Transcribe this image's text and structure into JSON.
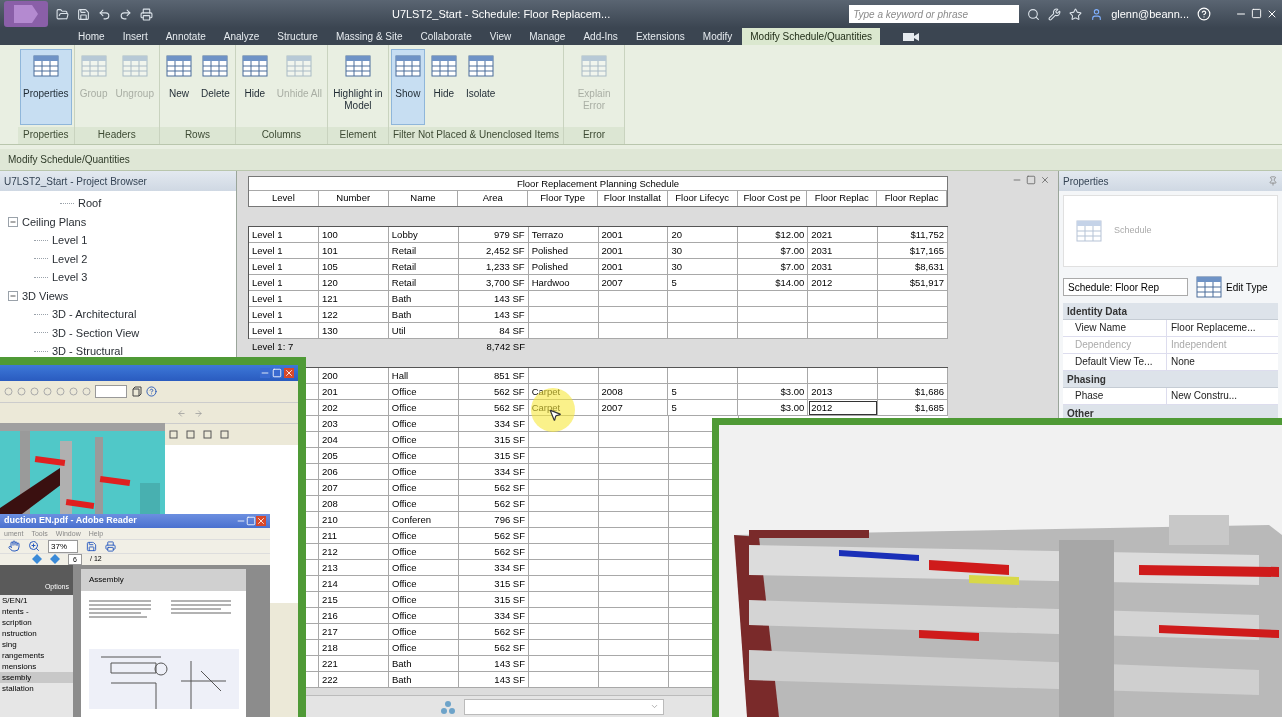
{
  "window": {
    "title": "U7LST2_Start - Schedule: Floor Replacem...",
    "search_placeholder": "Type a keyword or phrase",
    "user": "glenn@beann..."
  },
  "tabs": [
    {
      "label": "Home",
      "selected": false
    },
    {
      "label": "Insert",
      "selected": false
    },
    {
      "label": "Annotate",
      "selected": false
    },
    {
      "label": "Analyze",
      "selected": false
    },
    {
      "label": "Structure",
      "selected": false
    },
    {
      "label": "Massing & Site",
      "selected": false
    },
    {
      "label": "Collaborate",
      "selected": false
    },
    {
      "label": "View",
      "selected": false
    },
    {
      "label": "Manage",
      "selected": false
    },
    {
      "label": "Add-Ins",
      "selected": false
    },
    {
      "label": "Extensions",
      "selected": false
    },
    {
      "label": "Modify",
      "selected": false
    },
    {
      "label": "Modify Schedule/Quantities",
      "selected": true
    }
  ],
  "ribbon": {
    "panels": [
      {
        "label": "Properties",
        "buttons": [
          {
            "label": "Properties",
            "disabled": false,
            "active": true
          }
        ]
      },
      {
        "label": "Headers",
        "buttons": [
          {
            "label": "Group",
            "disabled": true,
            "active": false
          },
          {
            "label": "Ungroup",
            "disabled": true,
            "active": false
          }
        ]
      },
      {
        "label": "Rows",
        "buttons": [
          {
            "label": "New",
            "disabled": false,
            "active": false
          },
          {
            "label": "Delete",
            "disabled": false,
            "active": false
          }
        ]
      },
      {
        "label": "Columns",
        "buttons": [
          {
            "label": "Hide",
            "disabled": false,
            "active": false
          },
          {
            "label": "Unhide All",
            "disabled": true,
            "active": false
          }
        ]
      },
      {
        "label": "Element",
        "buttons": [
          {
            "label": "Highlight in Model",
            "disabled": false,
            "active": false
          }
        ]
      },
      {
        "label": "Filter Not Placed & Unenclosed Items",
        "buttons": [
          {
            "label": "Show",
            "disabled": false,
            "active": true
          },
          {
            "label": "Hide",
            "disabled": false,
            "active": false
          },
          {
            "label": "Isolate",
            "disabled": false,
            "active": false
          }
        ]
      },
      {
        "label": "Error",
        "buttons": [
          {
            "label": "Explain Error",
            "disabled": true,
            "active": false
          }
        ]
      }
    ]
  },
  "context_bar": "Modify Schedule/Quantities",
  "browser": {
    "title": "U7LST2_Start - Project Browser",
    "tree": [
      {
        "children": [
          {
            "label": "Roof"
          }
        ]
      },
      {
        "label": "Ceiling Plans",
        "expanded": true,
        "children": [
          {
            "label": "Level 1"
          },
          {
            "label": "Level 2"
          },
          {
            "label": "Level 3"
          }
        ]
      },
      {
        "label": "3D Views",
        "expanded": true,
        "children": [
          {
            "label": "3D - Architectural"
          },
          {
            "label": "3D - Section View"
          },
          {
            "label": "3D - Structural"
          }
        ]
      }
    ]
  },
  "schedule": {
    "title": "Floor Replacement Planning Schedule",
    "columns": [
      "Level",
      "Number",
      "Name",
      "Area",
      "Floor Type",
      "Floor Installat",
      "Floor Lifecyc",
      "Floor Cost pe",
      "Floor Replac",
      "Floor Replac"
    ],
    "groups": [
      {
        "rows": [
          {
            "level": "Level 1",
            "number": "100",
            "name": "Lobby",
            "area": "979 SF",
            "floor_type": "Terrazo",
            "installed": "2001",
            "lifecycle": "20",
            "cost": "$12.00",
            "replace_year": "2021",
            "replace_cost": "$11,752",
            "active": false
          },
          {
            "level": "Level 1",
            "number": "101",
            "name": "Retail",
            "area": "2,452 SF",
            "floor_type": "Polished",
            "installed": "2001",
            "lifecycle": "30",
            "cost": "$7.00",
            "replace_year": "2031",
            "replace_cost": "$17,165",
            "active": false
          },
          {
            "level": "Level 1",
            "number": "105",
            "name": "Retail",
            "area": "1,233 SF",
            "floor_type": "Polished",
            "installed": "2001",
            "lifecycle": "30",
            "cost": "$7.00",
            "replace_year": "2031",
            "replace_cost": "$8,631",
            "active": false
          },
          {
            "level": "Level 1",
            "number": "120",
            "name": "Retail",
            "area": "3,700 SF",
            "floor_type": "Hardwoo",
            "installed": "2007",
            "lifecycle": "5",
            "cost": "$14.00",
            "replace_year": "2012",
            "replace_cost": "$51,917",
            "active": false
          },
          {
            "level": "Level 1",
            "number": "121",
            "name": "Bath",
            "area": "143 SF",
            "active": false
          },
          {
            "level": "Level 1",
            "number": "122",
            "name": "Bath",
            "area": "143 SF",
            "active": false
          },
          {
            "level": "Level 1",
            "number": "130",
            "name": "Util",
            "area": "84 SF",
            "active": false
          }
        ],
        "footer": {
          "label": "Level 1: 7",
          "area": "8,742 SF"
        }
      },
      {
        "rows": [
          {
            "number": "200",
            "name": "Hall",
            "area": "851 SF",
            "active": false
          },
          {
            "number": "201",
            "name": "Office",
            "area": "562 SF",
            "floor_type": "Carpet",
            "installed": "2008",
            "lifecycle": "5",
            "cost": "$3.00",
            "replace_year": "2013",
            "replace_cost": "$1,686",
            "active": false
          },
          {
            "number": "202",
            "name": "Office",
            "area": "562 SF",
            "floor_type": "Carpet",
            "installed": "2007",
            "lifecycle": "5",
            "cost": "$3.00",
            "replace_year": "2012",
            "replace_cost": "$1,685",
            "active": true
          },
          {
            "number": "203",
            "name": "Office",
            "area": "334 SF"
          },
          {
            "number": "204",
            "name": "Office",
            "area": "315 SF"
          },
          {
            "number": "205",
            "name": "Office",
            "area": "315 SF"
          },
          {
            "number": "206",
            "name": "Office",
            "area": "334 SF"
          },
          {
            "number": "207",
            "name": "Office",
            "area": "562 SF"
          },
          {
            "number": "208",
            "name": "Office",
            "area": "562 SF"
          },
          {
            "number": "210",
            "name": "Conferen",
            "area": "796 SF"
          },
          {
            "number": "211",
            "name": "Office",
            "area": "562 SF"
          },
          {
            "number": "212",
            "name": "Office",
            "area": "562 SF"
          },
          {
            "number": "213",
            "name": "Office",
            "area": "334 SF"
          },
          {
            "number": "214",
            "name": "Office",
            "area": "315 SF"
          },
          {
            "number": "215",
            "name": "Office",
            "area": "315 SF"
          },
          {
            "number": "216",
            "name": "Office",
            "area": "334 SF"
          },
          {
            "number": "217",
            "name": "Office",
            "area": "562 SF"
          },
          {
            "number": "218",
            "name": "Office",
            "area": "562 SF"
          },
          {
            "number": "221",
            "name": "Bath",
            "area": "143 SF"
          },
          {
            "number": "222",
            "name": "Bath",
            "area": "143 SF"
          }
        ]
      }
    ]
  },
  "properties": {
    "title": "Properties",
    "type_label": "Schedule",
    "type_selector": "Schedule: Floor Rep",
    "edit_type": "Edit Type",
    "groups": [
      {
        "label": "Identity Data",
        "rows": [
          {
            "name": "View Name",
            "value": "Floor Replaceme...",
            "disabled": false
          },
          {
            "name": "Dependency",
            "value": "Independent",
            "disabled": true
          },
          {
            "name": "Default View Te...",
            "value": "None",
            "disabled": false
          }
        ]
      },
      {
        "label": "Phasing",
        "rows": [
          {
            "name": "Phase",
            "value": "New Constru...",
            "disabled": false
          }
        ]
      },
      {
        "label": "Other"
      }
    ]
  },
  "reader": {
    "title": "duction EN.pdf - Adobe Reader",
    "menu": [
      "ument",
      "Tools",
      "Window",
      "Help"
    ],
    "zoom": "37%",
    "page": "6",
    "page_count": "/ 12",
    "options": "Options",
    "bookmarks": [
      {
        "label": "S/EN/1",
        "selected": false
      },
      {
        "label": "ntents -",
        "selected": false
      },
      {
        "label": "scription",
        "selected": false
      },
      {
        "label": "nstruction",
        "selected": false
      },
      {
        "label": "sing",
        "selected": false
      },
      {
        "label": "rangements",
        "selected": false
      },
      {
        "label": "mensions",
        "selected": false
      },
      {
        "label": "ssembly",
        "selected": true
      },
      {
        "label": "stallation",
        "selected": false
      }
    ],
    "page_heading": "Assembly"
  }
}
